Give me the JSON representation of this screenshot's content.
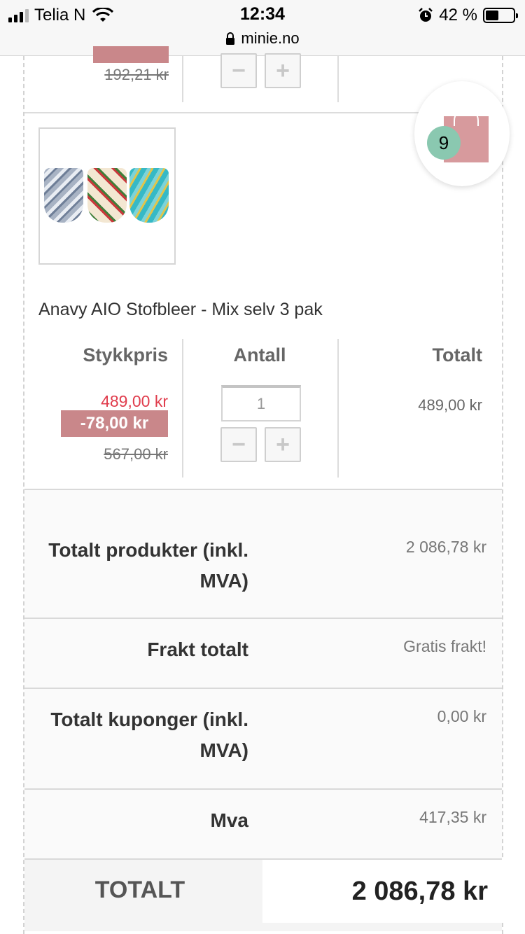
{
  "status_bar": {
    "carrier": "Telia N",
    "time": "12:34",
    "url": "minie.no",
    "battery_percent": "42 %",
    "battery_level": 0.42
  },
  "previous_item": {
    "old_price": "192,21 kr"
  },
  "cart": {
    "count": "9",
    "icon": "shopping-bag-icon"
  },
  "product": {
    "name": "Anavy AIO Stofbleer - Mix selv 3 pak",
    "columns": {
      "unit_price": "Stykkpris",
      "quantity": "Antall",
      "total": "Totalt"
    },
    "unit_price": "489,00 kr",
    "discount": "-78,00 kr",
    "old_price": "567,00 kr",
    "quantity": "1",
    "line_total": "489,00 kr",
    "minus_label": "−",
    "plus_label": "+"
  },
  "summary": {
    "products_total_label_1": "Totalt produkter (inkl.",
    "products_total_label_2": "MVA)",
    "products_total_value": "2 086,78 kr",
    "shipping_label": "Frakt totalt",
    "shipping_value": "Gratis frakt!",
    "coupons_label_1": "Totalt kuponger (inkl.",
    "coupons_label_2": "MVA)",
    "coupons_value": "0,00 kr",
    "vat_label": "Mva",
    "vat_value": "417,35 kr",
    "grand_total_label": "TOTALT",
    "grand_total_value": "2 086,78 kr"
  },
  "colors": {
    "discount_badge": "#c9878a",
    "sale_price": "#e03c4c",
    "cart_badge": "#8ac8b0",
    "bag": "#d79a9d"
  }
}
